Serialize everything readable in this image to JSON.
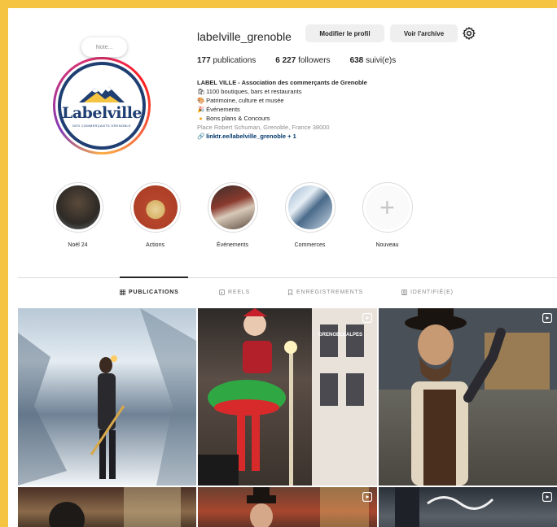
{
  "profile": {
    "username": "labelville_grenoble",
    "edit_button": "Modifier le profil",
    "archive_button": "Voir l'archive",
    "note_placeholder": "Note...",
    "logo_text": "Labelville",
    "logo_subtext": "DES COMMERÇANTS GRENOBLE"
  },
  "stats": {
    "publications_count": "177",
    "publications_label": "publications",
    "followers_count": "6 227",
    "followers_label": "followers",
    "following_count": "638",
    "following_label": "suivi(e)s"
  },
  "bio": {
    "name": "LABEL VILLE - Association des commerçants de Grenoble",
    "line1": "1100 boutiques, bars et restaurants",
    "line2": "Patrimoine, culture et musée",
    "line3": "Événements",
    "line4": "Bons plans & Concours",
    "address": "Place Robert Schuman, Grenoble, France 38000",
    "link": "linktr.ee/labelville_grenoble + 1"
  },
  "highlights": [
    {
      "label": "Noël 24"
    },
    {
      "label": "Actions"
    },
    {
      "label": "Événements"
    },
    {
      "label": "Commerces"
    },
    {
      "label": "Nouveau"
    }
  ],
  "tabs": {
    "publications": "PUBLICATIONS",
    "reels": "REELS",
    "saved": "ENREGISTREMENTS",
    "tagged": "IDENTIFIÉ(E)"
  },
  "posts": {
    "post2_overlay": "GRENOBLEALPES"
  },
  "colors": {
    "accent": "#f5c542",
    "logo_blue": "#1f3f73",
    "link": "#00376b"
  }
}
